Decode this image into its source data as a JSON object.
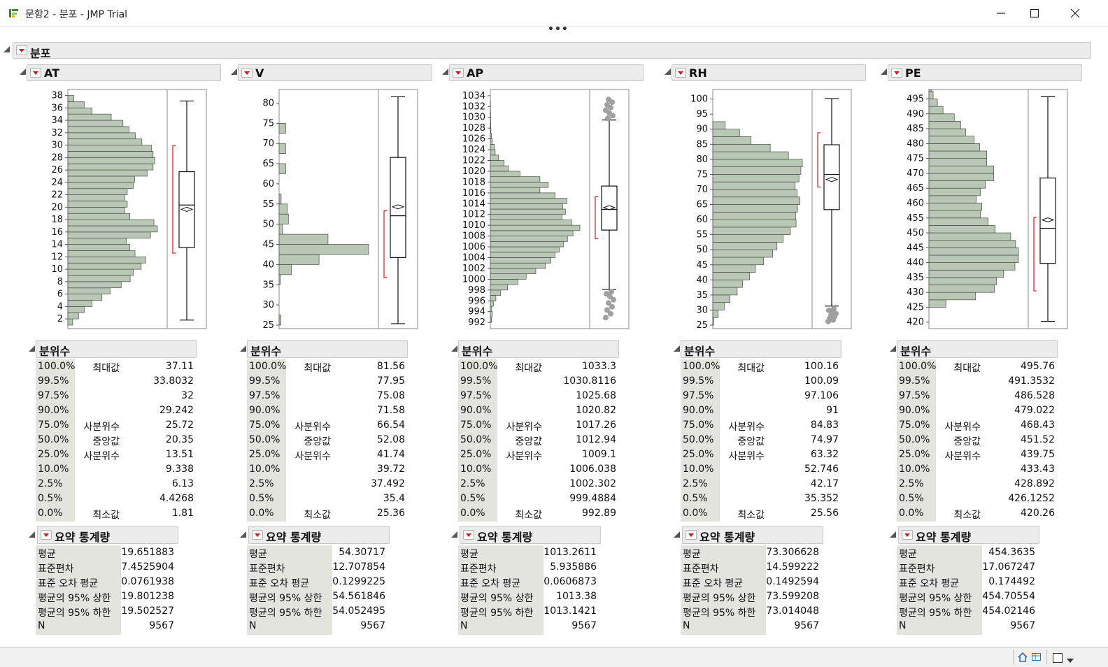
{
  "window": {
    "title": "문항2 - 분포 - JMP Trial"
  },
  "report": {
    "title": "분포"
  },
  "quantiles_title": "분위수",
  "summary_title": "요약 통계량",
  "quantile_levels": [
    "100.0%",
    "99.5%",
    "97.5%",
    "90.0%",
    "75.0%",
    "50.0%",
    "25.0%",
    "10.0%",
    "2.5%",
    "0.5%",
    "0.0%"
  ],
  "quantile_names": [
    "최대값",
    "",
    "",
    "",
    "사분위수",
    "중앙값",
    "사분위수",
    "",
    "",
    "",
    "최소값"
  ],
  "summary_labels": [
    "평균",
    "표준편차",
    "표준 오차 평균",
    "평균의 95% 상한",
    "평균의 95% 하한",
    "N"
  ],
  "colors": {
    "hist_fill": "#b9c8b4",
    "hist_stroke": "#4a4a4a",
    "ci_bracket": "#d9141e",
    "outlier": "#a0a0a0"
  },
  "panels": [
    {
      "name": "AT",
      "axis": {
        "min": 1,
        "max": 38.4,
        "ticks": [
          2,
          4,
          6,
          8,
          10,
          12,
          14,
          16,
          18,
          20,
          22,
          24,
          26,
          28,
          30,
          32,
          34,
          36,
          38
        ]
      },
      "hist": {
        "edges_start": 1,
        "bin_width": 1,
        "counts": [
          28,
          62,
          95,
          140,
          198,
          245,
          310,
          362,
          380,
          426,
          452,
          390,
          360,
          340,
          480,
          520,
          500,
          360,
          330,
          345,
          330,
          345,
          380,
          388,
          460,
          495,
          505,
          495,
          485,
          430,
          392,
          355,
          320,
          252,
          140,
          95,
          35
        ]
      },
      "box": {
        "q1": 13.51,
        "median": 20.35,
        "q3": 25.72,
        "whisker_low": 1.81,
        "whisker_high": 37.11,
        "mean": 19.651883,
        "ci_low": 12.6,
        "ci_high": 29.9,
        "outliers_low": [],
        "outliers_high": []
      },
      "quantiles": [
        "37.11",
        "33.8032",
        "32",
        "29.242",
        "25.72",
        "20.35",
        "13.51",
        "9.338",
        "6.13",
        "4.4268",
        "1.81"
      ],
      "summary": [
        "19.651883",
        "7.4525904",
        "0.0761938",
        "19.801238",
        "19.502527",
        "9567"
      ]
    },
    {
      "name": "V",
      "axis": {
        "min": 25,
        "max": 82.5,
        "ticks": [
          25,
          30,
          35,
          40,
          45,
          50,
          55,
          60,
          65,
          70,
          75,
          80
        ]
      },
      "hist": {
        "edges_start": 25,
        "bin_width": 2.5,
        "counts": [
          25,
          0,
          0,
          0,
          18,
          180,
          580,
          1300,
          710,
          48,
          135,
          118,
          30,
          0,
          0,
          95,
          0,
          95,
          0,
          95,
          0,
          0,
          0,
          0,
          0,
          0,
          0,
          0,
          0,
          0
        ]
      },
      "box": {
        "q1": 41.74,
        "median": 52.08,
        "q3": 66.54,
        "whisker_low": 25.36,
        "whisker_high": 81.56,
        "mean": 54.30717,
        "ci_low": 36.8,
        "ci_high": 53.3,
        "outliers_low": [],
        "outliers_high": []
      },
      "quantiles": [
        "81.56",
        "77.95",
        "75.08",
        "71.58",
        "66.54",
        "52.08",
        "41.74",
        "39.72",
        "37.492",
        "35.4",
        "25.36"
      ],
      "summary": [
        "54.30717",
        "12.707854",
        "0.1299225",
        "54.561846",
        "54.052495",
        "9567"
      ]
    },
    {
      "name": "AP",
      "axis": {
        "min": 991.5,
        "max": 1034.5,
        "ticks": [
          992,
          994,
          996,
          998,
          1000,
          1002,
          1004,
          1006,
          1008,
          1010,
          1012,
          1014,
          1016,
          1018,
          1020,
          1022,
          1024,
          1026,
          1028,
          1030,
          1032,
          1034
        ]
      },
      "hist": {
        "edges_start": 992,
        "bin_width": 1,
        "counts": [
          8,
          14,
          10,
          22,
          40,
          75,
          125,
          200,
          260,
          330,
          400,
          440,
          470,
          500,
          530,
          560,
          600,
          650,
          590,
          520,
          545,
          525,
          555,
          470,
          360,
          420,
          360,
          215,
          130,
          100,
          60,
          35,
          28,
          14,
          8,
          4,
          3,
          2,
          2,
          1,
          1,
          0
        ]
      },
      "box": {
        "q1": 1009.1,
        "median": 1012.94,
        "q3": 1017.26,
        "whisker_low": 998.1,
        "whisker_high": 1029.5,
        "mean": 1013.2611,
        "ci_low": 1007.5,
        "ci_high": 1015.3,
        "outliers_low": [
          992.9,
          993.6,
          994.3,
          994.9,
          995.6,
          996.2,
          996.8,
          997.3,
          997.7
        ],
        "outliers_high": [
          1029.8,
          1030.3,
          1030.8,
          1031.3,
          1031.8,
          1032.3,
          1032.8,
          1033.3
        ]
      },
      "quantiles": [
        "1033.3",
        "1030.8116",
        "1025.68",
        "1020.82",
        "1017.26",
        "1012.94",
        "1009.1",
        "1006.038",
        "1002.302",
        "999.4884",
        "992.89"
      ],
      "summary": [
        "1013.2611",
        "5.935886",
        "0.0606873",
        "1013.38",
        "1013.1421",
        "9567"
      ]
    },
    {
      "name": "RH",
      "axis": {
        "min": 25,
        "max": 102,
        "ticks": [
          25,
          30,
          35,
          40,
          45,
          50,
          55,
          60,
          65,
          70,
          75,
          80,
          85,
          90,
          95,
          100
        ]
      },
      "hist": {
        "edges_start": 25,
        "bin_width": 2.5,
        "counts": [
          10,
          55,
          120,
          180,
          255,
          310,
          385,
          445,
          530,
          625,
          670,
          735,
          810,
          870,
          865,
          885,
          910,
          880,
          860,
          900,
          920,
          935,
          790,
          600,
          400,
          280,
          130
        ]
      },
      "box": {
        "q1": 63.32,
        "median": 74.97,
        "q3": 84.83,
        "whisker_low": 31.3,
        "whisker_high": 100.16,
        "mean": 73.306628,
        "ci_low": 70.8,
        "ci_high": 88.8,
        "outliers_low": [
          26.2,
          26.7,
          27.2,
          27.8,
          28.3,
          28.8,
          29.4,
          29.9,
          30.4
        ],
        "outliers_high": []
      },
      "quantiles": [
        "100.16",
        "100.09",
        "97.106",
        "91",
        "84.83",
        "74.97",
        "63.32",
        "52.746",
        "42.17",
        "35.352",
        "25.56"
      ],
      "summary": [
        "73.306628",
        "14.599222",
        "0.1492594",
        "73.599208",
        "73.014048",
        "9567"
      ]
    },
    {
      "name": "PE",
      "axis": {
        "min": 419,
        "max": 497,
        "ticks": [
          420,
          425,
          430,
          435,
          440,
          445,
          450,
          455,
          460,
          465,
          470,
          475,
          480,
          485,
          490,
          495
        ]
      },
      "hist": {
        "edges_start": 420,
        "bin_width": 2.5,
        "counts": [
          0,
          0,
          120,
          330,
          465,
          480,
          530,
          610,
          635,
          635,
          615,
          580,
          470,
          420,
          365,
          375,
          335,
          365,
          400,
          460,
          460,
          410,
          410,
          360,
          320,
          260,
          225,
          180,
          100,
          60,
          30,
          18
        ]
      },
      "box": {
        "q1": 439.75,
        "median": 451.52,
        "q3": 468.43,
        "whisker_low": 420.26,
        "whisker_high": 495.76,
        "mean": 454.3635,
        "ci_low": 430.5,
        "ci_high": 455.2,
        "outliers_low": [],
        "outliers_high": []
      },
      "quantiles": [
        "495.76",
        "491.3532",
        "486.528",
        "479.022",
        "468.43",
        "451.52",
        "439.75",
        "433.43",
        "428.892",
        "426.1252",
        "420.26"
      ],
      "summary": [
        "454.3635",
        "17.067247",
        "0.174492",
        "454.70554",
        "454.02146",
        "9567"
      ]
    }
  ]
}
